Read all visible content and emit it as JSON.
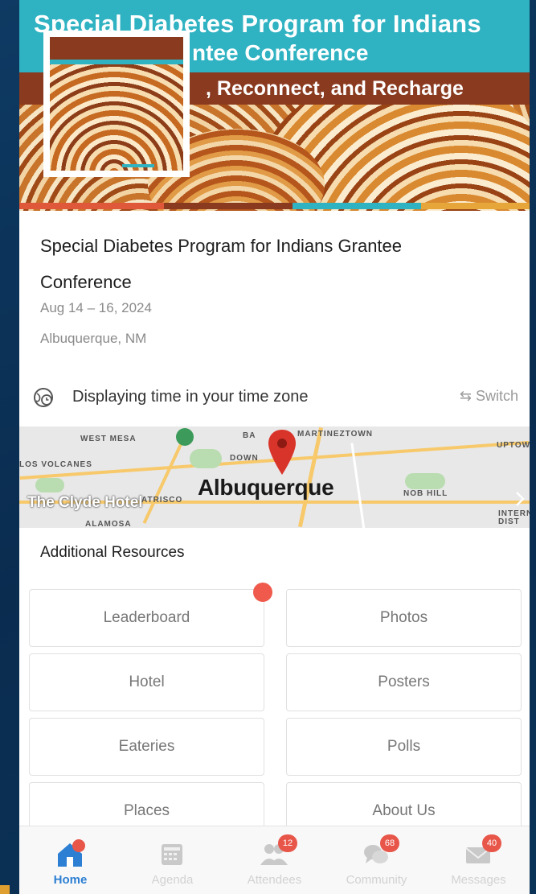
{
  "banner": {
    "title_line1": "Special Diabetes Program for Indians",
    "title_line2": "ntee Conference",
    "tagline": ", Reconnect, and Recharge"
  },
  "event": {
    "title": "Special Diabetes Program for Indians Grantee Conference",
    "dates": "Aug 14 – 16, 2024",
    "location": "Albuquerque, NM"
  },
  "timezone": {
    "icon": "globe-clock-icon",
    "text": "Displaying time in your time zone",
    "switch_label": "⇆ Switch"
  },
  "map": {
    "city_label": "Albuquerque",
    "hotel_label": "The Clyde Hotel",
    "area_labels": [
      "WEST MESA",
      "LOS VOLCANES",
      "ATRISCO",
      "ALAMOSA",
      "MARTINEZTOWN",
      "NOB HILL",
      "UPTOWN",
      "INTERN DIST",
      "DOWN",
      "BA"
    ],
    "pin_icon": "map-pin-icon"
  },
  "resources": {
    "title": "Additional Resources",
    "tiles": [
      "Leaderboard",
      "Photos",
      "Hotel",
      "Posters",
      "Eateries",
      "Polls",
      "Places",
      "About Us"
    ]
  },
  "tabs": [
    {
      "label": "Home",
      "icon": "home-icon",
      "active": true,
      "badge": ""
    },
    {
      "label": "Agenda",
      "icon": "calendar-icon",
      "active": false,
      "badge": ""
    },
    {
      "label": "Attendees",
      "icon": "people-icon",
      "active": false,
      "badge": "12"
    },
    {
      "label": "Community",
      "icon": "chat-bubbles-icon",
      "active": false,
      "badge": "68"
    },
    {
      "label": "Messages",
      "icon": "envelope-icon",
      "active": false,
      "badge": "40"
    }
  ],
  "colors": {
    "accent": "#2d7fd3",
    "badge": "#e8564a",
    "banner_teal": "#2fb2c2",
    "banner_brown": "#8a3a1f"
  }
}
